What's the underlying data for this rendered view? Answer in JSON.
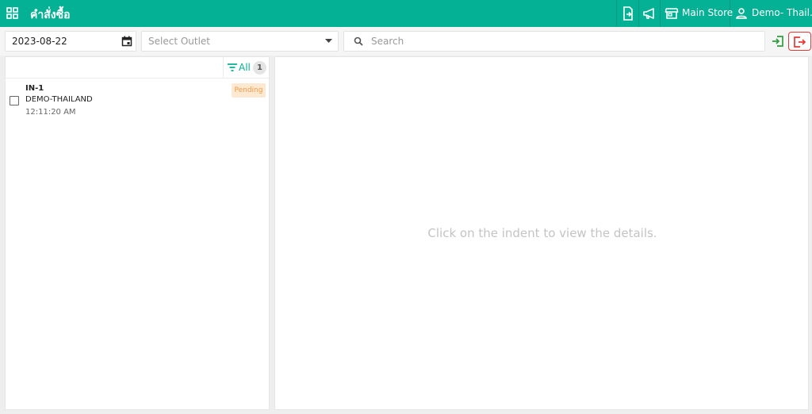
{
  "header": {
    "title": "คำสั่งซื้อ",
    "store": "Main Store",
    "user": "Demo- Thail..."
  },
  "filters": {
    "date": "2023-08-22",
    "outlet_placeholder": "Select Outlet",
    "search_placeholder": "Search"
  },
  "list": {
    "filter_label": "All",
    "count": "1",
    "orders": [
      {
        "id": "IN-1",
        "outlet": "DEMO-THAILAND",
        "time": "12:11:20 AM",
        "status": "Pending"
      }
    ]
  },
  "detail": {
    "empty_message": "Click on the indent to view the details."
  },
  "colors": {
    "primary": "#05b194",
    "pending_bg": "#fde8d2",
    "pending_text": "#f49b45",
    "logout": "#e53935",
    "import": "#2e9e3a"
  },
  "icons": [
    "apps-icon",
    "import-order-icon",
    "announcement-icon",
    "store-icon",
    "user-icon",
    "calendar-icon",
    "dropdown-arrow-icon",
    "search-icon",
    "login-icon",
    "logout-icon",
    "filter-icon"
  ]
}
